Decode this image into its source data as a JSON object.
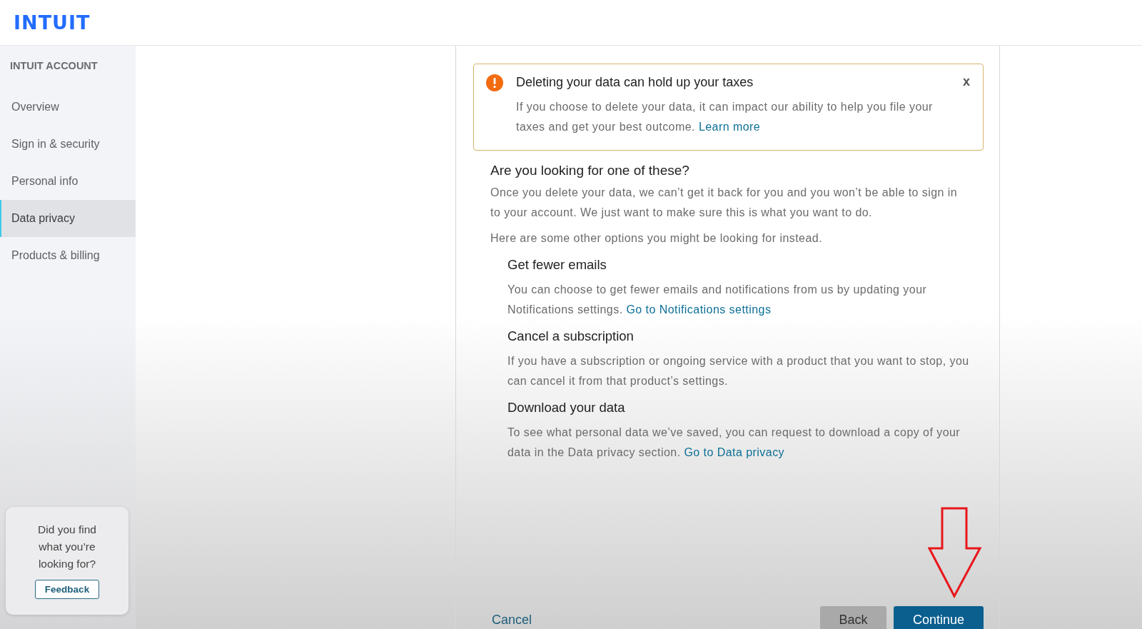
{
  "header": {
    "logo": "INTUIT"
  },
  "sidebar": {
    "heading": "INTUIT ACCOUNT",
    "items": [
      {
        "label": "Overview",
        "selected": false
      },
      {
        "label": "Sign in & security",
        "selected": false
      },
      {
        "label": "Personal info",
        "selected": false
      },
      {
        "label": "Data privacy",
        "selected": true
      },
      {
        "label": "Products & billing",
        "selected": false
      }
    ]
  },
  "feedback": {
    "question": "Did you find what you’re looking for?",
    "button": "Feedback"
  },
  "alert": {
    "title": "Deleting your data can hold up your taxes",
    "close": "x",
    "text": "If you choose to delete your data, it can impact our ability to help you file your taxes and get your best outcome.",
    "link": "Learn more"
  },
  "heading": "Are you looking for one of these?",
  "paragraphs": [
    "Once you delete your data, we can’t get it back for you and you won’t be able to sign in to your account. We just want to make sure this is what you want to do.",
    "Here are some other options you might be looking for instead."
  ],
  "options": [
    {
      "title": "Get fewer emails",
      "text": "You can choose to get fewer emails and notifications from us by updating your Notifications settings.",
      "link": "Go to Notifications settings"
    },
    {
      "title": "Cancel a subscription",
      "text": "If you have a subscription or ongoing service with a product that you want to stop, you can cancel it from that product’s settings."
    },
    {
      "title": "Download your data",
      "text": "To see what personal data we’ve saved, you can request to download a copy of your data in the Data privacy section.",
      "link": "Go to Data privacy"
    }
  ],
  "actions": [
    {
      "label": "Cancel",
      "kind": "link"
    },
    {
      "label": "Back",
      "kind": "secondary"
    },
    {
      "label": "Continue",
      "kind": "primary"
    }
  ]
}
